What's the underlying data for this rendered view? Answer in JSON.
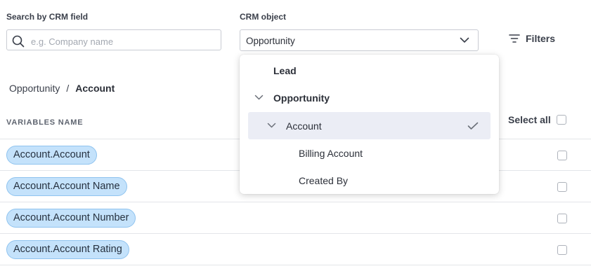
{
  "search": {
    "label": "Search by CRM field",
    "placeholder": "e.g. Company name",
    "value": ""
  },
  "crm_object": {
    "label": "CRM object",
    "selected": "Opportunity"
  },
  "filters": {
    "label": "Filters"
  },
  "breadcrumb": {
    "parent": "Opportunity",
    "separator": "/",
    "current": "Account"
  },
  "table": {
    "column_header": "VARIABLES NAME",
    "select_all_label": "Select all",
    "rows": [
      {
        "name": "Account.Account",
        "checked": false
      },
      {
        "name": "Account.Account Name",
        "checked": false
      },
      {
        "name": "Account.Account Number",
        "checked": false
      },
      {
        "name": "Account.Account Rating",
        "checked": false
      }
    ]
  },
  "dropdown": {
    "items": [
      {
        "label": "Lead",
        "level": 0,
        "expanded": false
      },
      {
        "label": "Opportunity",
        "level": 0,
        "expanded": true
      },
      {
        "label": "Account",
        "level": 1,
        "expanded": true,
        "selected": true
      },
      {
        "label": "Billing Account",
        "level": 2
      },
      {
        "label": "Created By",
        "level": 2
      }
    ]
  },
  "icons": [
    "search-icon",
    "chevron-down-icon",
    "filter-icon",
    "checkmark-icon"
  ],
  "colors": {
    "pill_bg": "#c4e2fb",
    "pill_border": "#8fc3ef",
    "selected_item_bg": "#ebedf5"
  }
}
